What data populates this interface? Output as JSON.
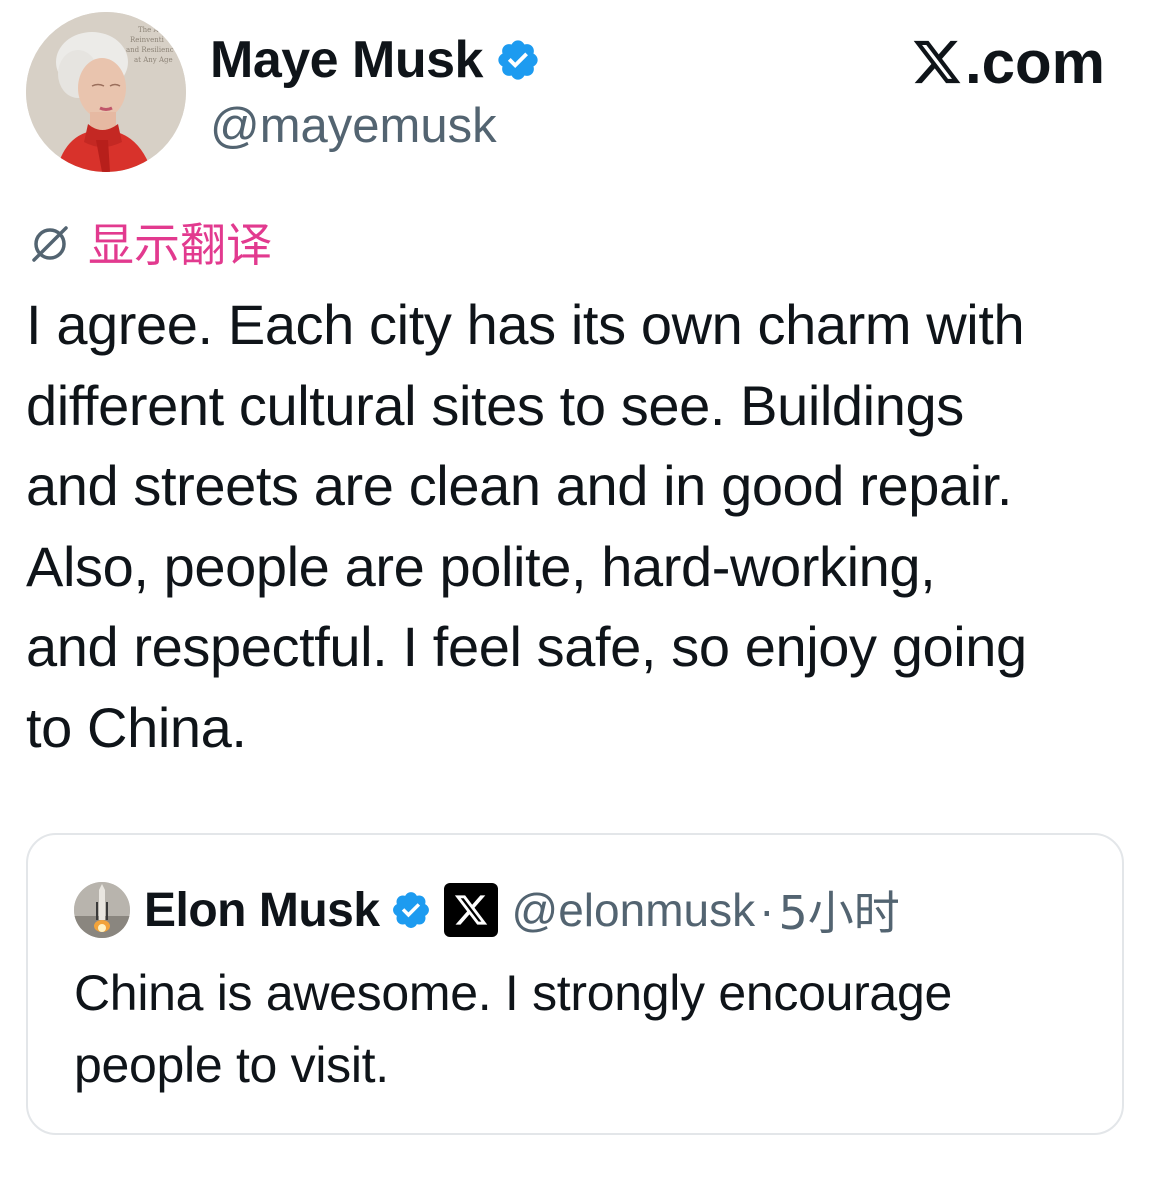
{
  "author": {
    "display_name": "Maye Musk",
    "handle": "@mayemusk",
    "avatar_book_text": [
      "The A",
      "Reinventi",
      "and Resilienc",
      "at Any Age"
    ]
  },
  "site_logo": {
    "text": ".com",
    "icon": "x-logo-icon"
  },
  "translate": {
    "label": "显示翻译",
    "icon": "translate-icon"
  },
  "tweet": {
    "lines": [
      "I agree. Each city has its own charm with",
      "different cultural sites to see. Buildings",
      "and streets are clean and in good repair.",
      "Also, people are polite, hard-working,",
      "and respectful. I feel safe, so enjoy going",
      "to China."
    ]
  },
  "quoted_tweet": {
    "display_name": "Elon Musk",
    "handle": "@elonmusk",
    "separator": "·",
    "time": "5小时",
    "lines": [
      "China is awesome. I strongly encourage",
      "people to visit."
    ]
  },
  "colors": {
    "verified_blue": "#1d9bf0",
    "translate_pink": "#e23a8f",
    "secondary_text": "#536471",
    "primary_text": "#0f1419",
    "card_border": "#e3e6e9"
  }
}
